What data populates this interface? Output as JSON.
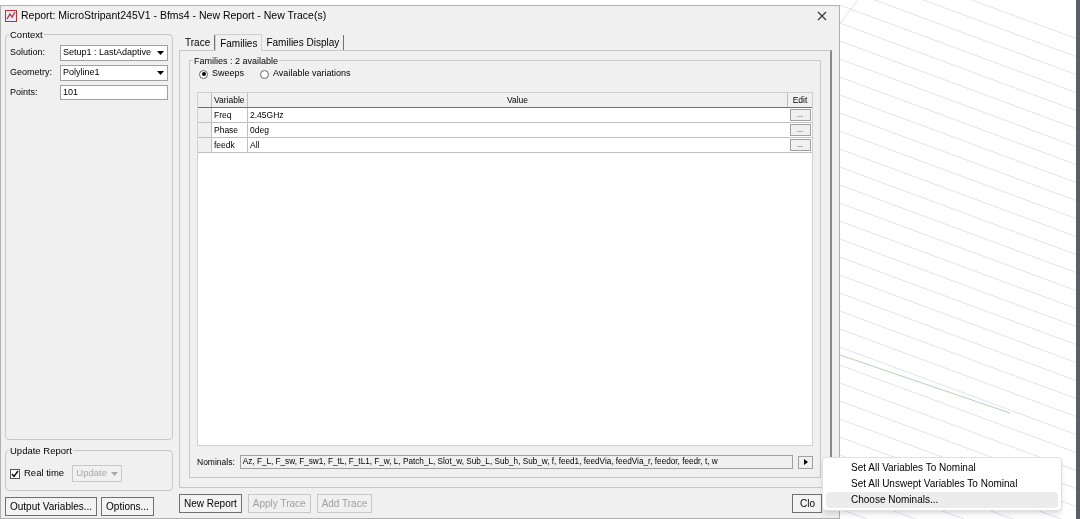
{
  "window": {
    "title": "Report: MicroStripant245V1 - Bfms4 - New Report - New Trace(s)"
  },
  "context": {
    "title": "Context",
    "fields": [
      {
        "label": "Solution:",
        "value": "Setup1 : LastAdaptive",
        "kind": "dropdown"
      },
      {
        "label": "Geometry:",
        "value": "Polyline1",
        "kind": "dropdown"
      },
      {
        "label": "Points:",
        "value": "101",
        "kind": "text"
      }
    ]
  },
  "update_report": {
    "title": "Update Report",
    "real_time": {
      "label": "Real time",
      "checked": true
    },
    "update_button": {
      "label": "Update",
      "disabled": true
    }
  },
  "left_buttons": [
    "Output Variables...",
    "Options..."
  ],
  "tabs": [
    {
      "label": "Trace",
      "selected": false
    },
    {
      "label": "Families",
      "selected": true
    },
    {
      "label": "Families Display",
      "selected": false
    }
  ],
  "families": {
    "title": "Families : 2 available",
    "modes": [
      {
        "label": "Sweeps",
        "selected": true
      },
      {
        "label": "Available variations",
        "selected": false
      }
    ],
    "columns": [
      "Variable",
      "Value",
      "Edit"
    ],
    "rows": [
      {
        "variable": "Freq",
        "value": "2.45GHz",
        "edit": "..."
      },
      {
        "variable": "Phase",
        "value": "0deg",
        "edit": "..."
      },
      {
        "variable": "feedk",
        "value": "All",
        "edit": "..."
      }
    ],
    "nominals_label": "Nominals:",
    "nominals": "Az, F_L, F_sw, F_sw1, F_tL, F_tL1, F_w, L, Patch_L, Slot_w, Sub_L, Sub_h, Sub_w, f, feed1, feedVia, feedVia_r, feedor, feedr, t, w"
  },
  "bottom_buttons": [
    {
      "label": "New Report",
      "disabled": false
    },
    {
      "label": "Apply Trace",
      "disabled": true
    },
    {
      "label": "Add Trace",
      "disabled": true
    }
  ],
  "close_button": "Clo",
  "menu": [
    {
      "label": "Set All Variables To Nominal",
      "selected": false
    },
    {
      "label": "Set All Unswept Variables To Nominal",
      "selected": false
    },
    {
      "label": "Choose Nominals...",
      "selected": true
    }
  ]
}
